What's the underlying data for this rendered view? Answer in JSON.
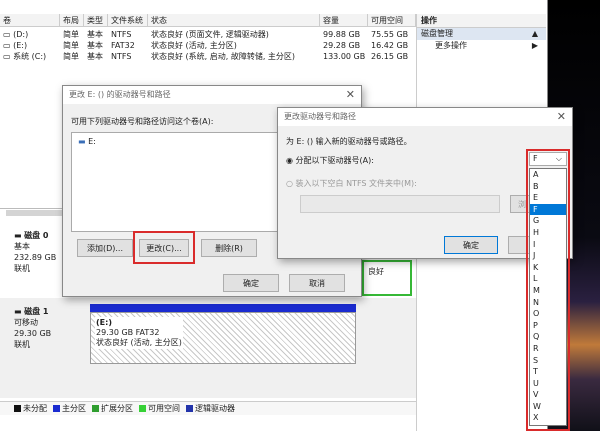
{
  "table": {
    "headers": [
      "卷",
      "布局",
      "类型",
      "文件系统",
      "状态",
      "容量",
      "可用空间"
    ],
    "rows": [
      [
        "(D:)",
        "简单",
        "基本",
        "NTFS",
        "状态良好 (页面文件, 逻辑驱动器)",
        "99.88 GB",
        "75.55 GB"
      ],
      [
        "(E:)",
        "简单",
        "基本",
        "FAT32",
        "状态良好 (活动, 主分区)",
        "29.28 GB",
        "16.42 GB"
      ],
      [
        "系统 (C:)",
        "简单",
        "基本",
        "NTFS",
        "状态良好 (系统, 启动, 故障转储, 主分区)",
        "133.00 GB",
        "26.15 GB"
      ]
    ]
  },
  "ops": {
    "header": "操作",
    "item1": "磁盘管理",
    "item2": "更多操作"
  },
  "disks": [
    {
      "name": "磁盘 0",
      "type": "基本",
      "size": "232.89 GB",
      "status": "联机"
    },
    {
      "name": "磁盘 1",
      "type": "可移动",
      "size": "29.30 GB",
      "status": "联机"
    }
  ],
  "disk1_partition": {
    "label": "(E:)",
    "size": "29.30 GB FAT32",
    "status": "状态良好 (活动, 主分区)"
  },
  "status_snippet": "良好",
  "legend": [
    "未分配",
    "主分区",
    "扩展分区",
    "可用空间",
    "逻辑驱动器"
  ],
  "legend_colors": [
    "#111111",
    "#1a2bd0",
    "#2f9e2f",
    "#36d136",
    "#2233aa"
  ],
  "dialog1": {
    "title": "更改 E: () 的驱动器号和路径",
    "prompt": "可用下列驱动器号和路径访问这个卷(A):",
    "entry": "E:",
    "add": "添加(D)...",
    "change": "更改(C)...",
    "remove": "删除(R)",
    "ok": "确定",
    "cancel": "取消"
  },
  "dialog2": {
    "title": "更改驱动器号和路径",
    "prompt": "为 E: () 输入新的驱动器号或路径。",
    "assign": "分配以下驱动器号(A):",
    "mount": "装入以下空白 NTFS 文件夹中(M):",
    "browse": "浏",
    "ok": "确定",
    "selected": "F",
    "letters": [
      "A",
      "B",
      "E",
      "F",
      "G",
      "H",
      "I",
      "J",
      "K",
      "L",
      "M",
      "N",
      "O",
      "P",
      "Q",
      "R",
      "S",
      "T",
      "U",
      "V",
      "W",
      "X"
    ]
  }
}
